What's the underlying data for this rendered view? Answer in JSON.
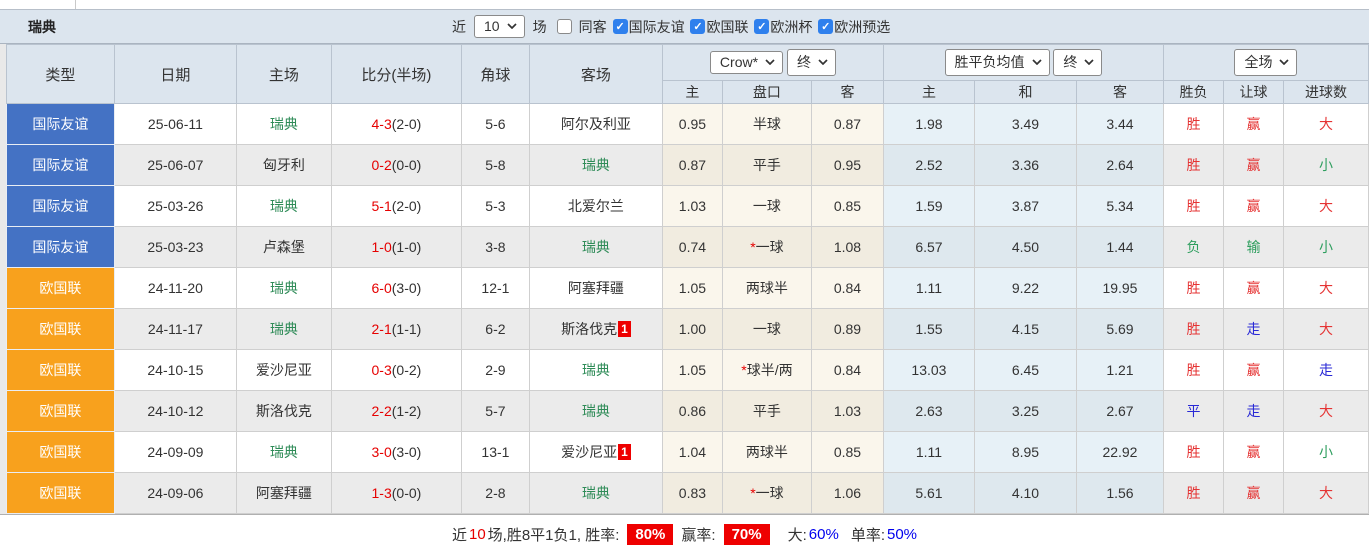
{
  "page": {
    "title": "瑞典",
    "filters": {
      "recent_label": "近",
      "recent_value": "10",
      "matches_label": "场",
      "same_venue_label": "同客",
      "same_venue_checked": false,
      "competitions": [
        {
          "label": "国际友谊",
          "checked": true
        },
        {
          "label": "欧国联",
          "checked": true
        },
        {
          "label": "欧洲杯",
          "checked": true
        },
        {
          "label": "欧洲预选",
          "checked": true
        }
      ]
    }
  },
  "table": {
    "selects": {
      "handicap_company": "Crow*",
      "handicap_time": "终",
      "odds_type": "胜平负均值",
      "odds_time": "终",
      "result_scope": "全场"
    },
    "columns": [
      "类型",
      "日期",
      "主场",
      "比分(半场)",
      "角球",
      "客场"
    ],
    "sub_columns": [
      "主",
      "盘口",
      "客",
      "主",
      "和",
      "客",
      "胜负",
      "让球",
      "进球数"
    ],
    "rows": [
      {
        "type": "国际友谊",
        "type_color": "blue",
        "date": "25-06-11",
        "home": "瑞典",
        "home_is_target": true,
        "score": "4-3",
        "half": "(2-0)",
        "corners": "5-6",
        "away": "阿尔及利亚",
        "away_is_target": false,
        "away_badge": "",
        "asia_home": "0.95",
        "handicap_star": false,
        "handicap": "半球",
        "asia_away": "0.87",
        "odds_home": "1.98",
        "odds_draw": "3.49",
        "odds_away": "3.44",
        "result": "胜",
        "result_color": "red",
        "handicap_result": "赢",
        "handicap_result_color": "red",
        "goals_result": "大",
        "goals_result_color": "red"
      },
      {
        "type": "国际友谊",
        "type_color": "blue",
        "date": "25-06-07",
        "home": "匈牙利",
        "home_is_target": false,
        "score": "0-2",
        "half": "(0-0)",
        "corners": "5-8",
        "away": "瑞典",
        "away_is_target": true,
        "away_badge": "",
        "asia_home": "0.87",
        "handicap_star": false,
        "handicap": "平手",
        "asia_away": "0.95",
        "odds_home": "2.52",
        "odds_draw": "3.36",
        "odds_away": "2.64",
        "result": "胜",
        "result_color": "red",
        "handicap_result": "赢",
        "handicap_result_color": "red",
        "goals_result": "小",
        "goals_result_color": "green"
      },
      {
        "type": "国际友谊",
        "type_color": "blue",
        "date": "25-03-26",
        "home": "瑞典",
        "home_is_target": true,
        "score": "5-1",
        "half": "(2-0)",
        "corners": "5-3",
        "away": "北爱尔兰",
        "away_is_target": false,
        "away_badge": "",
        "asia_home": "1.03",
        "handicap_star": false,
        "handicap": "一球",
        "asia_away": "0.85",
        "odds_home": "1.59",
        "odds_draw": "3.87",
        "odds_away": "5.34",
        "result": "胜",
        "result_color": "red",
        "handicap_result": "赢",
        "handicap_result_color": "red",
        "goals_result": "大",
        "goals_result_color": "red"
      },
      {
        "type": "国际友谊",
        "type_color": "blue",
        "date": "25-03-23",
        "home": "卢森堡",
        "home_is_target": false,
        "score": "1-0",
        "half": "(1-0)",
        "corners": "3-8",
        "away": "瑞典",
        "away_is_target": true,
        "away_badge": "",
        "asia_home": "0.74",
        "handicap_star": true,
        "handicap": "一球",
        "asia_away": "1.08",
        "odds_home": "6.57",
        "odds_draw": "4.50",
        "odds_away": "1.44",
        "result": "负",
        "result_color": "green",
        "handicap_result": "输",
        "handicap_result_color": "green",
        "goals_result": "小",
        "goals_result_color": "green"
      },
      {
        "type": "欧国联",
        "type_color": "orange",
        "date": "24-11-20",
        "home": "瑞典",
        "home_is_target": true,
        "score": "6-0",
        "half": "(3-0)",
        "corners": "12-1",
        "away": "阿塞拜疆",
        "away_is_target": false,
        "away_badge": "",
        "asia_home": "1.05",
        "handicap_star": false,
        "handicap": "两球半",
        "asia_away": "0.84",
        "odds_home": "1.11",
        "odds_draw": "9.22",
        "odds_away": "19.95",
        "result": "胜",
        "result_color": "red",
        "handicap_result": "赢",
        "handicap_result_color": "red",
        "goals_result": "大",
        "goals_result_color": "red"
      },
      {
        "type": "欧国联",
        "type_color": "orange",
        "date": "24-11-17",
        "home": "瑞典",
        "home_is_target": true,
        "score": "2-1",
        "half": "(1-1)",
        "corners": "6-2",
        "away": "斯洛伐克",
        "away_is_target": false,
        "away_badge": "1",
        "asia_home": "1.00",
        "handicap_star": false,
        "handicap": "一球",
        "asia_away": "0.89",
        "odds_home": "1.55",
        "odds_draw": "4.15",
        "odds_away": "5.69",
        "result": "胜",
        "result_color": "red",
        "handicap_result": "走",
        "handicap_result_color": "blue",
        "goals_result": "大",
        "goals_result_color": "red"
      },
      {
        "type": "欧国联",
        "type_color": "orange",
        "date": "24-10-15",
        "home": "爱沙尼亚",
        "home_is_target": false,
        "score": "0-3",
        "half": "(0-2)",
        "corners": "2-9",
        "away": "瑞典",
        "away_is_target": true,
        "away_badge": "",
        "asia_home": "1.05",
        "handicap_star": true,
        "handicap": "球半/两",
        "asia_away": "0.84",
        "odds_home": "13.03",
        "odds_draw": "6.45",
        "odds_away": "1.21",
        "result": "胜",
        "result_color": "red",
        "handicap_result": "赢",
        "handicap_result_color": "red",
        "goals_result": "走",
        "goals_result_color": "blue"
      },
      {
        "type": "欧国联",
        "type_color": "orange",
        "date": "24-10-12",
        "home": "斯洛伐克",
        "home_is_target": false,
        "score": "2-2",
        "half": "(1-2)",
        "corners": "5-7",
        "away": "瑞典",
        "away_is_target": true,
        "away_badge": "",
        "asia_home": "0.86",
        "handicap_star": false,
        "handicap": "平手",
        "asia_away": "1.03",
        "odds_home": "2.63",
        "odds_draw": "3.25",
        "odds_away": "2.67",
        "result": "平",
        "result_color": "blue",
        "handicap_result": "走",
        "handicap_result_color": "blue",
        "goals_result": "大",
        "goals_result_color": "red"
      },
      {
        "type": "欧国联",
        "type_color": "orange",
        "date": "24-09-09",
        "home": "瑞典",
        "home_is_target": true,
        "score": "3-0",
        "half": "(3-0)",
        "corners": "13-1",
        "away": "爱沙尼亚",
        "away_is_target": false,
        "away_badge": "1",
        "asia_home": "1.04",
        "handicap_star": false,
        "handicap": "两球半",
        "asia_away": "0.85",
        "odds_home": "1.11",
        "odds_draw": "8.95",
        "odds_away": "22.92",
        "result": "胜",
        "result_color": "red",
        "handicap_result": "赢",
        "handicap_result_color": "red",
        "goals_result": "小",
        "goals_result_color": "green"
      },
      {
        "type": "欧国联",
        "type_color": "orange",
        "date": "24-09-06",
        "home": "阿塞拜疆",
        "home_is_target": false,
        "score": "1-3",
        "half": "(0-0)",
        "corners": "2-8",
        "away": "瑞典",
        "away_is_target": true,
        "away_badge": "",
        "asia_home": "0.83",
        "handicap_star": true,
        "handicap": "一球",
        "asia_away": "1.06",
        "odds_home": "5.61",
        "odds_draw": "4.10",
        "odds_away": "1.56",
        "result": "胜",
        "result_color": "red",
        "handicap_result": "赢",
        "handicap_result_color": "red",
        "goals_result": "大",
        "goals_result_color": "red"
      }
    ]
  },
  "footer": {
    "prefix": "近",
    "count": "10",
    "mid": "场,胜8平1负1, 胜率:",
    "win_rate": "80%",
    "handicap_label": "赢率:",
    "handicap_rate": "70%",
    "big_label": "大:",
    "big_rate": "60%",
    "single_label": "单率:",
    "single_rate": "50%"
  },
  "colors": {
    "friendly_blue": "#4472c4",
    "nations_league_orange": "#f8a11d",
    "target_team_green": "#2e8b57",
    "score_red": "#e60000",
    "win_red": "#e53333",
    "lose_green": "#2e9e5e",
    "push_blue": "#2929d6",
    "badge_red": "#ee0000",
    "rate_value_blue": "#0000ee",
    "header_bg": "#dce5ee"
  }
}
